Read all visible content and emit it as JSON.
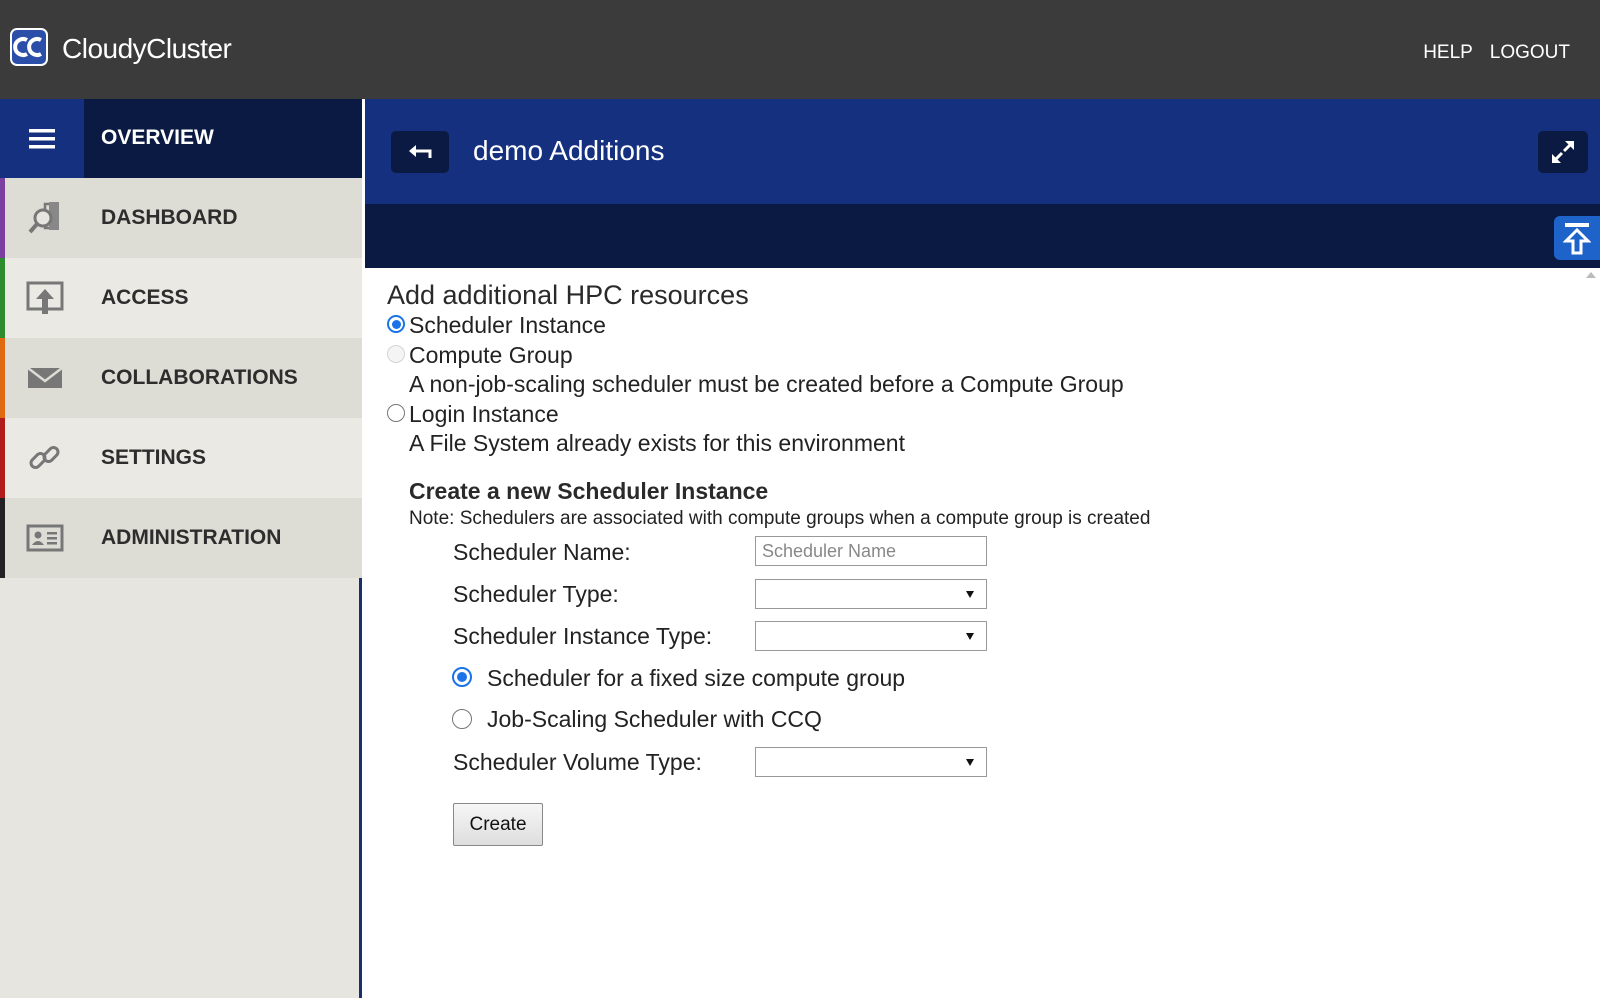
{
  "app": {
    "brand": "CloudyCluster",
    "logo_text": "CC",
    "top_links": {
      "help": "HELP",
      "logout": "LOGOUT"
    }
  },
  "sidebar": {
    "overview_label": "OVERVIEW",
    "items": [
      {
        "label": "DASHBOARD",
        "icon": "dashboard-icon",
        "accent": "#7b3fa0"
      },
      {
        "label": "ACCESS",
        "icon": "access-upload-icon",
        "accent": "#2e8b2e"
      },
      {
        "label": "COLLABORATIONS",
        "icon": "envelope-icon",
        "accent": "#e06a12"
      },
      {
        "label": "SETTINGS",
        "icon": "link-icon",
        "accent": "#b31c1c"
      },
      {
        "label": "ADMINISTRATION",
        "icon": "id-card-icon",
        "accent": "#222222"
      }
    ]
  },
  "header": {
    "title": "demo Additions"
  },
  "content": {
    "heading": "Add additional HPC resources",
    "options": [
      {
        "label": "Scheduler Instance",
        "checked": true,
        "disabled": false
      },
      {
        "label": "Compute Group",
        "checked": false,
        "disabled": true,
        "note": "A non-job-scaling scheduler must be created before a Compute Group"
      },
      {
        "label": "Login Instance",
        "checked": false,
        "disabled": false,
        "note": "A File System already exists for this environment"
      }
    ],
    "form": {
      "title": "Create a new Scheduler Instance",
      "note": "Note: Schedulers are associated with compute groups when a compute group is created",
      "name_label": "Scheduler Name:",
      "name_placeholder": "Scheduler Name",
      "type_label": "Scheduler Type:",
      "type_value": "",
      "instance_type_label": "Scheduler Instance Type:",
      "instance_type_value": "",
      "mode_options": [
        {
          "label": "Scheduler for a fixed size compute group",
          "checked": true
        },
        {
          "label": "Job-Scaling Scheduler with CCQ",
          "checked": false
        }
      ],
      "volume_type_label": "Scheduler Volume Type:",
      "volume_type_value": "",
      "create_label": "Create"
    }
  },
  "colors": {
    "topbar": "#3b3b3b",
    "header_blue": "#14307e",
    "navy": "#0b1a42",
    "accent_blue": "#1a73e8"
  }
}
